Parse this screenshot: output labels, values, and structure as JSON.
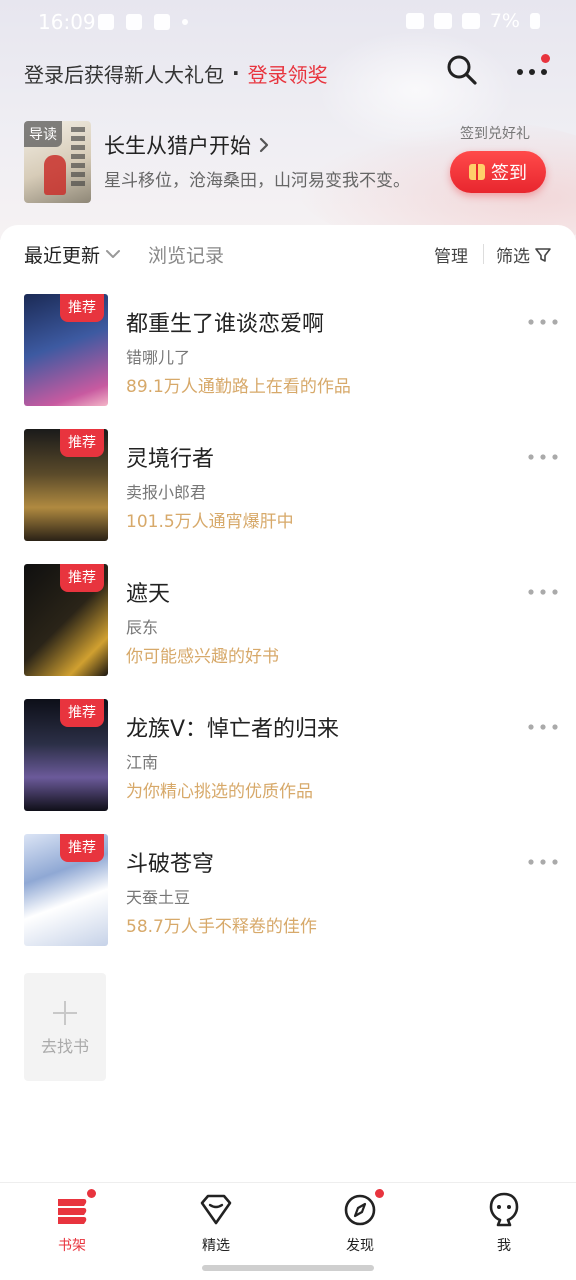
{
  "status_bar": {
    "time": "16:09",
    "battery": "7%"
  },
  "header": {
    "promo_text": "登录后获得新人大礼包",
    "separator": "·",
    "login_link": "登录领奖",
    "icons": [
      "search-icon",
      "more-icon"
    ]
  },
  "recommendation": {
    "cover_tag": "导读",
    "title": "长生从猎户开始",
    "description": "星斗移位，沧海桑田，山河易变我不变。",
    "signin_hint": "签到兑好礼",
    "signin_label": "签到"
  },
  "filters": {
    "recent": "最近更新",
    "history": "浏览记录",
    "manage": "管理",
    "filter": "筛选"
  },
  "books": [
    {
      "badge": "推荐",
      "title": "都重生了谁谈恋爱啊",
      "author": "错哪儿了",
      "note": "89.1万人通勤路上在看的作品"
    },
    {
      "badge": "推荐",
      "title": "灵境行者",
      "author": "卖报小郎君",
      "note": "101.5万人通宵爆肝中"
    },
    {
      "badge": "推荐",
      "title": "遮天",
      "author": "辰东",
      "note": "你可能感兴趣的好书"
    },
    {
      "badge": "推荐",
      "title": "龙族Ⅴ：悼亡者的归来",
      "author": "江南",
      "note": "为你精心挑选的优质作品"
    },
    {
      "badge": "推荐",
      "title": "斗破苍穹",
      "author": "天蚕土豆",
      "note": "58.7万人手不释卷的佳作"
    }
  ],
  "add_book_label": "去找书",
  "bottom_nav": [
    {
      "label": "书架",
      "icon": "bookshelf-icon",
      "active": true
    },
    {
      "label": "精选",
      "icon": "diamond-icon",
      "active": false
    },
    {
      "label": "发现",
      "icon": "compass-icon",
      "active": false
    },
    {
      "label": "我",
      "icon": "profile-icon",
      "active": false
    }
  ],
  "colors": {
    "accent": "#e8343e",
    "note": "#d7a96a"
  }
}
